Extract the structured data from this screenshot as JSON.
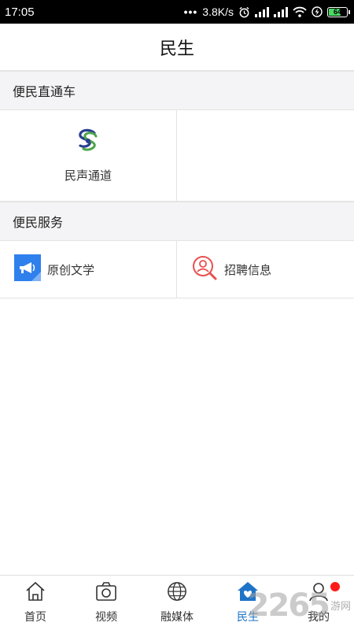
{
  "status_bar": {
    "time": "17:05",
    "dots": "•••",
    "speed": "3.8K/s",
    "battery": "64",
    "icons": [
      "alarm-icon",
      "signal-icon",
      "signal-icon",
      "wifi-icon",
      "charging-icon",
      "battery-icon"
    ]
  },
  "header": {
    "title": "民生"
  },
  "section1": {
    "title": "便民直通车",
    "items": [
      {
        "label": "民声通道",
        "icon": "minsheng-logo-icon"
      }
    ]
  },
  "section2": {
    "title": "便民服务",
    "items": [
      {
        "label": "原创文学",
        "icon": "megaphone-icon",
        "color": "#2f80ed"
      },
      {
        "label": "招聘信息",
        "icon": "search-person-icon",
        "color": "#e85050"
      }
    ]
  },
  "tabbar": {
    "tabs": [
      {
        "label": "首页",
        "icon": "home-icon"
      },
      {
        "label": "视频",
        "icon": "camera-icon"
      },
      {
        "label": "融媒体",
        "icon": "globe-icon"
      },
      {
        "label": "民生",
        "icon": "house-heart-icon",
        "active": true
      },
      {
        "label": "我的",
        "icon": "person-icon"
      }
    ],
    "active_color": "#1f74c8"
  },
  "watermark": {
    "number": "2265",
    "text": "游网"
  }
}
